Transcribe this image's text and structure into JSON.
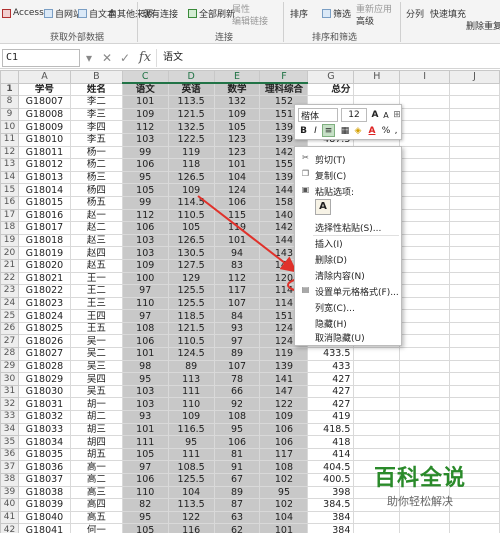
{
  "ribbon": {
    "access": "Access",
    "web": "自网站",
    "text": "自文本",
    "other_sources": "自其他来源",
    "existing_conn": "现有连接",
    "refresh_all": "全部刷新",
    "properties": "属性",
    "edit_links": "编辑链接",
    "sort_az": "A↓Z",
    "sort": "排序",
    "filter": "筛选",
    "reapply": "重新应用",
    "advanced": "高级",
    "text_to_columns": "分列",
    "flash_fill": "快速填充",
    "remove_duplicates": "删除重复项",
    "group_external": "获取外部数据",
    "group_connections": "连接",
    "group_sort_filter": "排序和筛选"
  },
  "formula_bar": {
    "name_box": "C1",
    "fx": "fx",
    "content": "语文"
  },
  "columns": [
    "A",
    "B",
    "C",
    "D",
    "E",
    "F",
    "G",
    "H",
    "I",
    "J"
  ],
  "rows": [
    {
      "n": "1",
      "c": [
        "学号",
        "姓名",
        "语文",
        "英语",
        "数学",
        "理科综合",
        "总分"
      ]
    },
    {
      "n": "8",
      "c": [
        "G18007",
        "李二",
        "101",
        "113.5",
        "132",
        "152",
        ""
      ]
    },
    {
      "n": "9",
      "c": [
        "G18008",
        "李三",
        "109",
        "121.5",
        "109",
        "151",
        ""
      ]
    },
    {
      "n": "10",
      "c": [
        "G18009",
        "李四",
        "112",
        "132.5",
        "105",
        "139",
        ""
      ]
    },
    {
      "n": "11",
      "c": [
        "G18010",
        "李五",
        "103",
        "122.5",
        "123",
        "139",
        "487.5"
      ]
    },
    {
      "n": "12",
      "c": [
        "G18011",
        "杨一",
        "99",
        "119",
        "123",
        "142",
        ""
      ]
    },
    {
      "n": "13",
      "c": [
        "G18012",
        "杨二",
        "106",
        "118",
        "101",
        "155",
        ""
      ]
    },
    {
      "n": "14",
      "c": [
        "G18013",
        "杨三",
        "95",
        "126.5",
        "104",
        "139",
        ""
      ]
    },
    {
      "n": "15",
      "c": [
        "G18014",
        "杨四",
        "105",
        "109",
        "124",
        "144",
        ""
      ]
    },
    {
      "n": "16",
      "c": [
        "G18015",
        "杨五",
        "99",
        "114.5",
        "106",
        "158",
        ""
      ]
    },
    {
      "n": "17",
      "c": [
        "G18016",
        "赵一",
        "112",
        "110.5",
        "115",
        "140",
        ""
      ]
    },
    {
      "n": "18",
      "c": [
        "G18017",
        "赵二",
        "106",
        "105",
        "119",
        "142",
        ""
      ]
    },
    {
      "n": "19",
      "c": [
        "G18018",
        "赵三",
        "103",
        "126.5",
        "101",
        "144",
        ""
      ]
    },
    {
      "n": "20",
      "c": [
        "G18019",
        "赵四",
        "103",
        "130.5",
        "94",
        "143",
        ""
      ]
    },
    {
      "n": "21",
      "c": [
        "G18020",
        "赵五",
        "109",
        "127.5",
        "83",
        "145",
        ""
      ]
    },
    {
      "n": "22",
      "c": [
        "G18021",
        "王一",
        "100",
        "129",
        "112",
        "120",
        ""
      ]
    },
    {
      "n": "23",
      "c": [
        "G18022",
        "王二",
        "97",
        "125.5",
        "117",
        "114",
        ""
      ]
    },
    {
      "n": "24",
      "c": [
        "G18023",
        "王三",
        "110",
        "125.5",
        "107",
        "114",
        ""
      ]
    },
    {
      "n": "25",
      "c": [
        "G18024",
        "王四",
        "97",
        "118.5",
        "84",
        "151",
        ""
      ]
    },
    {
      "n": "26",
      "c": [
        "G18025",
        "王五",
        "108",
        "121.5",
        "93",
        "124",
        ""
      ]
    },
    {
      "n": "27",
      "c": [
        "G18026",
        "吴一",
        "106",
        "110.5",
        "97",
        "124",
        ""
      ]
    },
    {
      "n": "28",
      "c": [
        "G18027",
        "吴二",
        "101",
        "124.5",
        "89",
        "119",
        "433.5"
      ]
    },
    {
      "n": "29",
      "c": [
        "G18028",
        "吴三",
        "98",
        "89",
        "107",
        "139",
        "433"
      ]
    },
    {
      "n": "30",
      "c": [
        "G18029",
        "吴四",
        "95",
        "113",
        "78",
        "141",
        "427"
      ]
    },
    {
      "n": "31",
      "c": [
        "G18030",
        "吴五",
        "103",
        "111",
        "66",
        "147",
        "427"
      ]
    },
    {
      "n": "32",
      "c": [
        "G18031",
        "胡一",
        "103",
        "110",
        "92",
        "122",
        "427"
      ]
    },
    {
      "n": "33",
      "c": [
        "G18032",
        "胡二",
        "93",
        "109",
        "108",
        "109",
        "419"
      ]
    },
    {
      "n": "34",
      "c": [
        "G18033",
        "胡三",
        "101",
        "116.5",
        "95",
        "106",
        "418.5"
      ]
    },
    {
      "n": "35",
      "c": [
        "G18034",
        "胡四",
        "111",
        "95",
        "106",
        "106",
        "418"
      ]
    },
    {
      "n": "36",
      "c": [
        "G18035",
        "胡五",
        "105",
        "111",
        "81",
        "117",
        "414"
      ]
    },
    {
      "n": "37",
      "c": [
        "G18036",
        "高一",
        "97",
        "108.5",
        "91",
        "108",
        "404.5"
      ]
    },
    {
      "n": "38",
      "c": [
        "G18037",
        "高二",
        "106",
        "125.5",
        "67",
        "102",
        "400.5"
      ]
    },
    {
      "n": "39",
      "c": [
        "G18038",
        "高三",
        "110",
        "104",
        "89",
        "95",
        "398"
      ]
    },
    {
      "n": "40",
      "c": [
        "G18039",
        "高四",
        "82",
        "113.5",
        "87",
        "102",
        "384.5"
      ]
    },
    {
      "n": "41",
      "c": [
        "G18040",
        "高五",
        "95",
        "122",
        "63",
        "104",
        "384"
      ]
    },
    {
      "n": "42",
      "c": [
        "G18041",
        "何一",
        "105",
        "116",
        "62",
        "101",
        "384"
      ]
    },
    {
      "n": "43",
      "c": [
        "G18042",
        "何二",
        "",
        "",
        "",
        "",
        "",
        ""
      ]
    }
  ],
  "mini_toolbar": {
    "font": "楷体",
    "size": "12",
    "bold": "B",
    "italic": "I",
    "align": "≡",
    "fontcolor": "A",
    "pct": "%",
    "comma": ","
  },
  "context_menu": {
    "cut": "剪切(T)",
    "copy": "复制(C)",
    "paste_options": "粘贴选项:",
    "paste_special": "选择性粘贴(S)...",
    "insert": "插入(I)",
    "delete": "删除(D)",
    "clear": "清除内容(N)",
    "format_cells": "设置单元格格式(F)...",
    "col_width": "列宽(C)...",
    "hide": "隐藏(H)",
    "unhide": "取消隐藏(U)"
  },
  "watermark": {
    "title": "百科全说",
    "subtitle": "助你轻松解决"
  },
  "colors": {
    "accent_green": "#217346",
    "highlight_red": "#e0312a",
    "selection_gray": "#c8c8c8"
  }
}
